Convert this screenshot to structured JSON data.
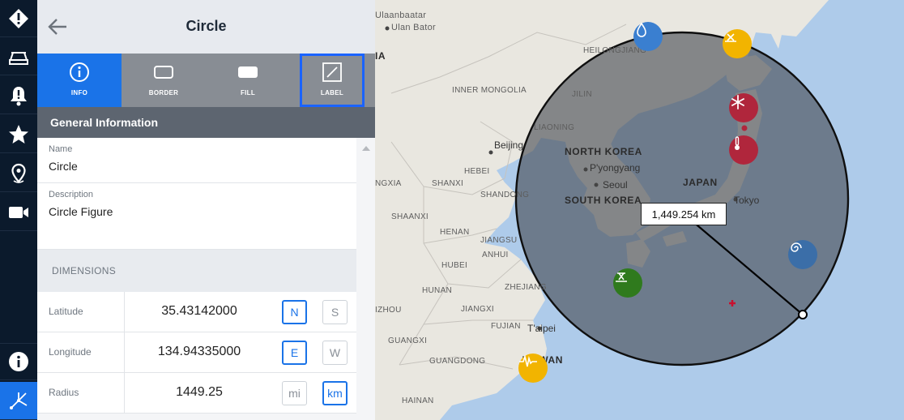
{
  "rail": {
    "items": [
      {
        "icon": "warning-diamond-icon"
      },
      {
        "icon": "layers-icon"
      },
      {
        "icon": "alert-bell-icon"
      },
      {
        "icon": "star-icon"
      },
      {
        "icon": "location-pin-icon"
      },
      {
        "icon": "video-camera-icon"
      },
      {
        "icon": "info-icon"
      },
      {
        "icon": "measure-tool-icon",
        "active": true
      }
    ]
  },
  "panel": {
    "title": "Circle",
    "tabs": [
      {
        "label": "INFO",
        "icon": "info-circle-icon",
        "active": true
      },
      {
        "label": "BORDER",
        "icon": "border-icon"
      },
      {
        "label": "FILL",
        "icon": "fill-icon"
      },
      {
        "label": "LABEL",
        "icon": "label-edit-icon",
        "highlighted": true
      }
    ],
    "section_title": "General Information",
    "name": {
      "label": "Name",
      "value": "Circle"
    },
    "description": {
      "label": "Description",
      "value": "Circle Figure"
    },
    "dimensions_title": "DIMENSIONS",
    "latitude": {
      "label": "Latitude",
      "value": "35.43142000",
      "units": [
        "N",
        "S"
      ],
      "selected": "N"
    },
    "longitude": {
      "label": "Longitude",
      "value": "134.94335000",
      "units": [
        "E",
        "W"
      ],
      "selected": "E"
    },
    "radius": {
      "label": "Radius",
      "value": "1449.25",
      "units": [
        "mi",
        "km"
      ],
      "selected": "km"
    }
  },
  "map": {
    "radius_label": "1,449.254 km",
    "labels": {
      "ulaanbaatar": "Ulaanbaatar",
      "ulan_bator": "Ulan Bator",
      "ia": "IA",
      "heilongjiang": "HEILONGJIANG",
      "inner_mongolia": "INNER MONGOLIA",
      "jilin": "JILIN",
      "liaoning": "LIAONING",
      "beijing": "Beijing",
      "hebei": "HEBEI",
      "north_korea": "NORTH KOREA",
      "pyongyang": "P'yongyang",
      "seoul": "Seoul",
      "south_korea": "SOUTH KOREA",
      "japan": "JAPAN",
      "tokyo": "Tokyo",
      "ningxia": "NGXIA",
      "shanxi": "SHANXI",
      "shandong": "SHANDONG",
      "shaanxi": "SHAANXI",
      "henan": "HENAN",
      "jiangsu": "JIANGSU",
      "anhui": "ANHUI",
      "hubei": "HUBEI",
      "hunan": "HUNAN",
      "zhejiang": "ZHEJIANG",
      "jiangxi": "JIANGXI",
      "guizhou": "IZHOU",
      "fujian": "FUJIAN",
      "taipei": "T'aipei",
      "taiwan": "TAIWAN",
      "guangxi": "GUANGXI",
      "guangdong": "GUANGDONG",
      "hainan": "HAINAN"
    },
    "markers": [
      {
        "icon": "fire-hydrant-icon",
        "color": "#3a7fd0"
      },
      {
        "icon": "volcano-icon",
        "color": "#f2b400"
      },
      {
        "icon": "snowflake-icon",
        "color": "#b0263c"
      },
      {
        "icon": "thermometer-icon",
        "color": "#b0263c"
      },
      {
        "icon": "cyclone-icon",
        "color": "#3b6ea8"
      },
      {
        "icon": "landslide-icon",
        "color": "#2f7a1d"
      },
      {
        "icon": "earthquake-icon",
        "color": "#f2b400"
      }
    ]
  }
}
